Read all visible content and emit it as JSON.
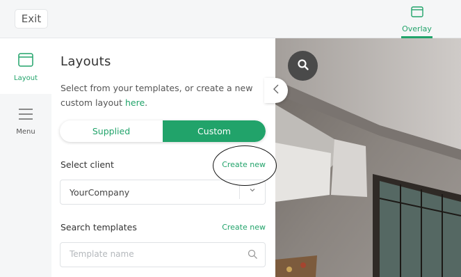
{
  "topbar": {
    "exit_label": "Exit",
    "overlay_label": "Overlay"
  },
  "nav": {
    "items": [
      {
        "label": "Layout",
        "active": true
      },
      {
        "label": "Menu",
        "active": false
      }
    ]
  },
  "panel": {
    "title": "Layouts",
    "description": "Select from your templates, or create a new custom layout ",
    "description_link": "here",
    "description_end": ".",
    "segment": {
      "options": [
        "Supplied",
        "Custom"
      ],
      "selected": "Custom"
    },
    "client": {
      "label": "Select client",
      "create_label": "Create new",
      "selected_value": "YourCompany"
    },
    "templates": {
      "label": "Search templates",
      "create_label": "Create new",
      "placeholder": "Template name",
      "value": ""
    }
  },
  "colors": {
    "accent": "#21a36a",
    "nav_bg": "#f5f6f7"
  },
  "icons": [
    "layout-icon",
    "menu-icon",
    "chevron-left-icon",
    "search-icon",
    "chevron-down-icon",
    "overlay-icon"
  ]
}
